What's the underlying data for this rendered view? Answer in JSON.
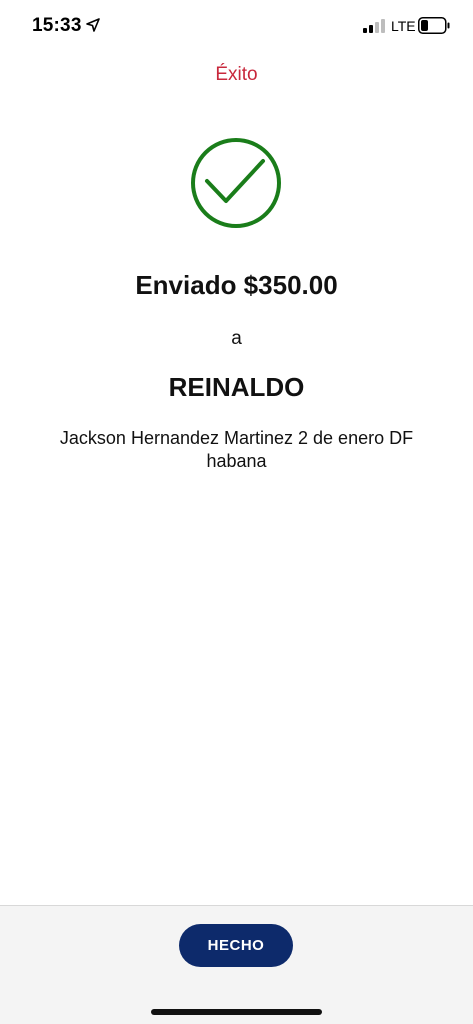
{
  "status_bar": {
    "time": "15:33",
    "network": "LTE"
  },
  "header": {
    "title": "Éxito"
  },
  "confirmation": {
    "sent_amount": "Enviado $350.00",
    "connector": "a",
    "recipient_name": "REINALDO",
    "recipient_address": "Jackson Hernandez Martinez 2 de enero DF habana"
  },
  "actions": {
    "done_label": "HECHO"
  },
  "colors": {
    "title": "#c8283c",
    "success": "#1a7d1a",
    "button": "#0d2a6b"
  }
}
